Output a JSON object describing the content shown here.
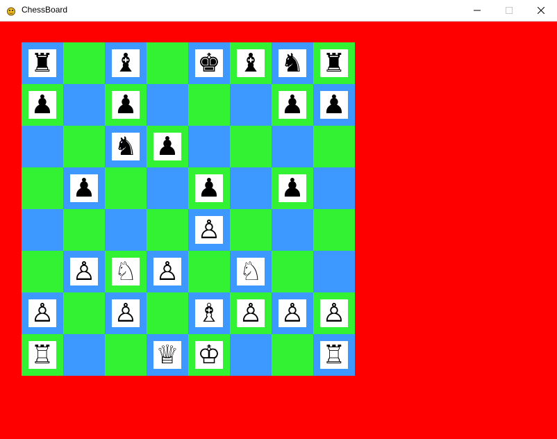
{
  "window": {
    "title": "ChessBoard",
    "app_icon": "pygame-snake-icon",
    "controls": [
      "minimize-icon",
      "maximize-icon",
      "close-icon"
    ]
  },
  "colors": {
    "background": "#ff0000",
    "light_square": "#33f233",
    "dark_square": "#3d98ff",
    "piece_tile": "#ffffff"
  },
  "board": {
    "rows": [
      [
        "r",
        "",
        "b",
        "",
        "k",
        "b",
        "n",
        "r"
      ],
      [
        "p",
        "",
        "p",
        "",
        "",
        "",
        "p",
        "p"
      ],
      [
        "",
        "",
        "n",
        "p",
        "",
        "",
        "",
        ""
      ],
      [
        "",
        "p",
        "",
        "",
        "p",
        "",
        "p",
        ""
      ],
      [
        "",
        "",
        "",
        "",
        "P",
        "",
        "",
        ""
      ],
      [
        "",
        "P",
        "N",
        "P",
        "",
        "N",
        "",
        ""
      ],
      [
        "P",
        "",
        "P",
        "",
        "B",
        "P",
        "P",
        "P"
      ],
      [
        "R",
        "",
        "",
        "Q",
        "K",
        "",
        "",
        "R"
      ]
    ]
  }
}
